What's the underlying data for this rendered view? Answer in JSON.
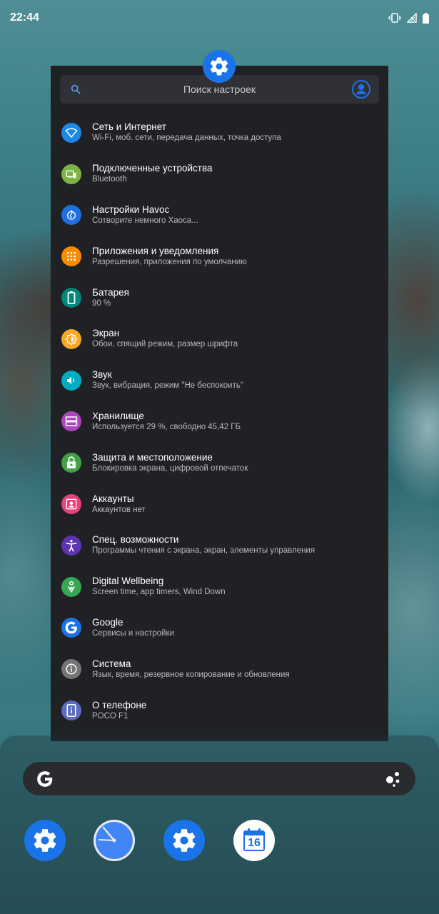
{
  "status_bar": {
    "time": "22:44",
    "icons": [
      "vibrate-icon",
      "no-signal-icon",
      "battery-icon"
    ]
  },
  "settings_panel": {
    "app_icon": "gear-icon",
    "search": {
      "placeholder": "Поиск настроек",
      "search_icon": "search-icon",
      "account_icon": "account-icon"
    },
    "items": [
      {
        "title": "Сеть и Интернет",
        "subtitle": "Wi-Fi, моб. сети, передача данных, точка доступа",
        "icon": "wifi-icon",
        "color": "#1e88e5"
      },
      {
        "title": "Подключенные устройства",
        "subtitle": "Bluetooth",
        "icon": "devices-icon",
        "color": "#7cb342"
      },
      {
        "title": "Настройки Havoc",
        "subtitle": "Сотворите немного Хаоса...",
        "icon": "havoc-icon",
        "color": "#1e6fe0"
      },
      {
        "title": "Приложения и уведомления",
        "subtitle": "Разрешения, приложения по умолчанию",
        "icon": "apps-grid-icon",
        "color": "#fb8c00"
      },
      {
        "title": "Батарея",
        "subtitle": "90 %",
        "icon": "battery-icon",
        "color": "#00897b"
      },
      {
        "title": "Экран",
        "subtitle": "Обои, спящий режим, размер шрифта",
        "icon": "brightness-icon",
        "color": "#f9a825"
      },
      {
        "title": "Звук",
        "subtitle": "Звук, вибрация, режим \"Не беспокоить\"",
        "icon": "volume-icon",
        "color": "#00acc1"
      },
      {
        "title": "Хранилище",
        "subtitle": "Используется 29 %, свободно 45,42 ГБ",
        "icon": "storage-icon",
        "color": "#ab47bc"
      },
      {
        "title": "Защита и местоположение",
        "subtitle": "Блокировка экрана, цифровой отпечаток",
        "icon": "lock-icon",
        "color": "#43a047"
      },
      {
        "title": "Аккаунты",
        "subtitle": "Аккаунтов нет",
        "icon": "account-box-icon",
        "color": "#ec407a"
      },
      {
        "title": "Спец. возможности",
        "subtitle": "Программы чтения с экрана, экран, элементы управления",
        "icon": "accessibility-icon",
        "color": "#5e35b1"
      },
      {
        "title": "Digital Wellbeing",
        "subtitle": "Screen time, app timers, Wind Down",
        "icon": "wellbeing-icon",
        "color": "#34a853"
      },
      {
        "title": "Google",
        "subtitle": "Сервисы и настройки",
        "icon": "google-icon",
        "color": "#1a73e8"
      },
      {
        "title": "Система",
        "subtitle": "Язык, время, резервное копирование и обновления",
        "icon": "info-icon",
        "color": "#757575"
      },
      {
        "title": "О телефоне",
        "subtitle": "POCO F1",
        "icon": "phone-info-icon",
        "color": "#5c6bc0"
      }
    ]
  },
  "home": {
    "search_bar_icons": [
      "google-g-icon",
      "assistant-icon"
    ],
    "dock_apps": [
      {
        "name": "settings-app",
        "icon": "gear-icon",
        "color": "#1a73e8"
      },
      {
        "name": "clock-app",
        "icon": "clock-icon",
        "color": "#1a73e8"
      },
      {
        "name": "settings-app-2",
        "icon": "gear-icon",
        "color": "#1a73e8"
      },
      {
        "name": "calendar-app",
        "icon": "calendar-icon",
        "color": "#1a73e8",
        "label": "16"
      }
    ]
  }
}
